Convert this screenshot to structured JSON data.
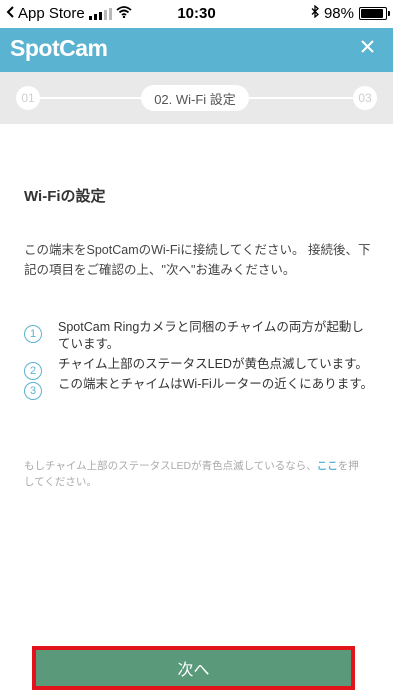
{
  "status_bar": {
    "carrier": "App Store",
    "time": "10:30",
    "battery_pct": "98%",
    "back_icon": "back-arrow-icon",
    "wifi_icon": "wifi-icon",
    "bluetooth_icon": "bluetooth-icon"
  },
  "header": {
    "logo": "SpotCam",
    "close_icon": "close-icon",
    "color": "#5ab3d1"
  },
  "steps": {
    "step1": "01",
    "current": "02. Wi-Fi 設定",
    "step3": "03"
  },
  "content": {
    "title": "Wi-Fiの設定",
    "intro": "この端末をSpotCamのWi-Fiに接続してください。 接続後、下記の項目をご確認の上、\"次へ\"お進みください。",
    "items": [
      {
        "num": "1",
        "text": "SpotCam Ringカメラと同梱のチャイムの両方が起動しています。"
      },
      {
        "num": "2",
        "text": "チャイム上部のステータスLEDが黄色点滅しています。"
      },
      {
        "num": "3",
        "text": "この端末とチャイムはWi-Fiルーターの近くにあります。"
      }
    ],
    "note_before": "もしチャイム上部のステータスLEDが青色点滅しているなら、",
    "note_link": "ここ",
    "note_after": "を押してください。"
  },
  "footer": {
    "next_label": "次へ",
    "button_color": "#5a9a7a",
    "highlight_color": "#e3131a"
  }
}
